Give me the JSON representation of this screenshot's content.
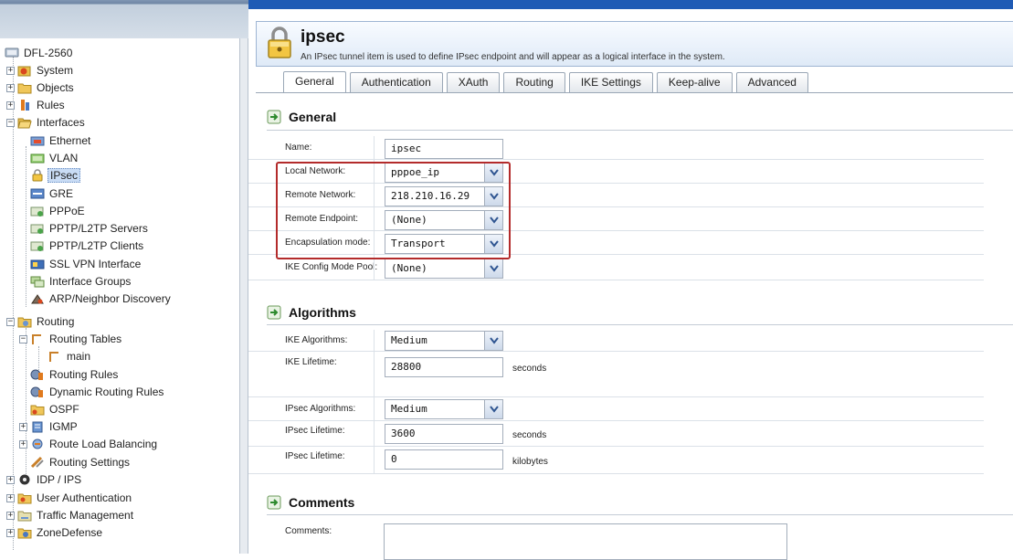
{
  "tree": [
    {
      "label": "DFL-2560",
      "icon": "device-icon"
    },
    {
      "label": "System",
      "icon": "system-icon"
    },
    {
      "label": "Objects",
      "icon": "folder-icon"
    },
    {
      "label": "Rules",
      "icon": "rules-icon"
    },
    {
      "label": "Interfaces",
      "icon": "folder-open-icon"
    },
    {
      "label": "Ethernet",
      "icon": "ethernet-icon"
    },
    {
      "label": "VLAN",
      "icon": "vlan-icon"
    },
    {
      "label": "IPsec",
      "icon": "lock-icon"
    },
    {
      "label": "GRE",
      "icon": "gre-icon"
    },
    {
      "label": "PPPoE",
      "icon": "pppoe-icon"
    },
    {
      "label": "PPTP/L2TP Servers",
      "icon": "pptp-server-icon"
    },
    {
      "label": "PPTP/L2TP Clients",
      "icon": "pptp-client-icon"
    },
    {
      "label": "SSL VPN Interface",
      "icon": "ssl-vpn-icon"
    },
    {
      "label": "Interface Groups",
      "icon": "interface-groups-icon"
    },
    {
      "label": "ARP/Neighbor Discovery",
      "icon": "arp-icon"
    },
    {
      "label": "Routing",
      "icon": "routing-folder-icon"
    },
    {
      "label": "Routing Tables",
      "icon": "routing-table-icon"
    },
    {
      "label": "main",
      "icon": "route-icon"
    },
    {
      "label": "Routing Rules",
      "icon": "routing-rules-icon"
    },
    {
      "label": "Dynamic Routing Rules",
      "icon": "dynamic-routing-icon"
    },
    {
      "label": "OSPF",
      "icon": "ospf-icon"
    },
    {
      "label": "IGMP",
      "icon": "igmp-icon"
    },
    {
      "label": "Route Load Balancing",
      "icon": "load-balance-icon"
    },
    {
      "label": "Routing Settings",
      "icon": "routing-settings-icon"
    },
    {
      "label": "IDP / IPS",
      "icon": "idp-icon"
    },
    {
      "label": "User Authentication",
      "icon": "user-auth-icon"
    },
    {
      "label": "Traffic Management",
      "icon": "traffic-icon"
    },
    {
      "label": "ZoneDefense",
      "icon": "zonedefense-icon"
    }
  ],
  "header": {
    "title": "ipsec",
    "description": "An IPsec tunnel item is used to define IPsec endpoint and will appear as a logical interface in the system."
  },
  "tabs": [
    "General",
    "Authentication",
    "XAuth",
    "Routing",
    "IKE Settings",
    "Keep-alive",
    "Advanced"
  ],
  "general": {
    "title": "General",
    "rows": [
      {
        "label": "Name:",
        "value": "ipsec"
      },
      {
        "label": "Local Network:",
        "value": "pppoe_ip"
      },
      {
        "label": "Remote Network:",
        "value": "218.210.16.29"
      },
      {
        "label": "Remote Endpoint:",
        "value": "(None)"
      },
      {
        "label": "Encapsulation mode:",
        "value": "Transport"
      },
      {
        "label": "IKE Config Mode Pool:",
        "value": "(None)"
      }
    ]
  },
  "algorithms": {
    "title": "Algorithms",
    "rows": [
      {
        "label": "IKE Algorithms:",
        "value": "Medium"
      },
      {
        "label": "IKE Lifetime:",
        "value": "28800",
        "unit": "seconds"
      },
      {
        "label": "IPsec Algorithms:",
        "value": "Medium"
      },
      {
        "label": "IPsec Lifetime:",
        "value": "3600",
        "unit": "seconds"
      },
      {
        "label": "IPsec Lifetime:",
        "value": "0",
        "unit": "kilobytes"
      }
    ]
  },
  "comments": {
    "title": "Comments",
    "label": "Comments:",
    "value": ""
  },
  "colors": {
    "accent": "#1f5bb5",
    "highlight": "#b32b2b",
    "selected": "#c9dcf5"
  }
}
